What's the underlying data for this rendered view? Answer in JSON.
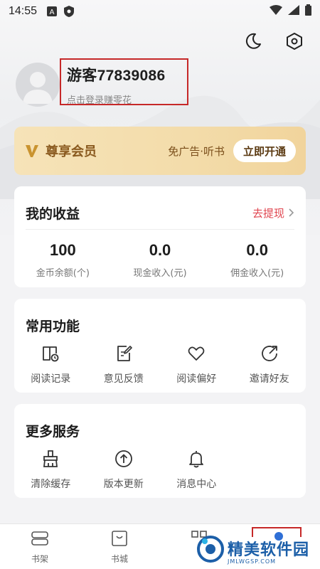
{
  "status_bar": {
    "time": "14:55"
  },
  "profile": {
    "username": "游客77839086",
    "login_hint": "点击登录赚零花"
  },
  "vip": {
    "title": "尊享会员",
    "benefits": "免广告·听书",
    "button": "立即开通"
  },
  "earnings": {
    "title": "我的收益",
    "withdraw": "去提现",
    "stats": [
      {
        "value": "100",
        "label": "金币余额(个)"
      },
      {
        "value": "0.0",
        "label": "现金收入(元)"
      },
      {
        "value": "0.0",
        "label": "佣金收入(元)"
      }
    ]
  },
  "functions": {
    "title": "常用功能",
    "items": [
      {
        "label": "阅读记录",
        "icon": "reading-history-icon"
      },
      {
        "label": "意见反馈",
        "icon": "feedback-icon"
      },
      {
        "label": "阅读偏好",
        "icon": "heart-icon"
      },
      {
        "label": "邀请好友",
        "icon": "share-icon"
      }
    ]
  },
  "services": {
    "title": "更多服务",
    "items": [
      {
        "label": "清除缓存",
        "icon": "broom-icon"
      },
      {
        "label": "版本更新",
        "icon": "upload-cloud-icon"
      },
      {
        "label": "消息中心",
        "icon": "bell-icon"
      }
    ]
  },
  "bottom_nav": {
    "items": [
      {
        "label": "书架",
        "icon": "bookshelf-icon"
      },
      {
        "label": "书城",
        "icon": "bookstore-icon"
      }
    ]
  },
  "watermark": {
    "main": "精美软件园",
    "sub": "JMLWGSP.COM"
  },
  "colors": {
    "accent_red": "#e0454f",
    "vip_gold": "#f3dcaa",
    "highlight_border": "#c62828"
  }
}
